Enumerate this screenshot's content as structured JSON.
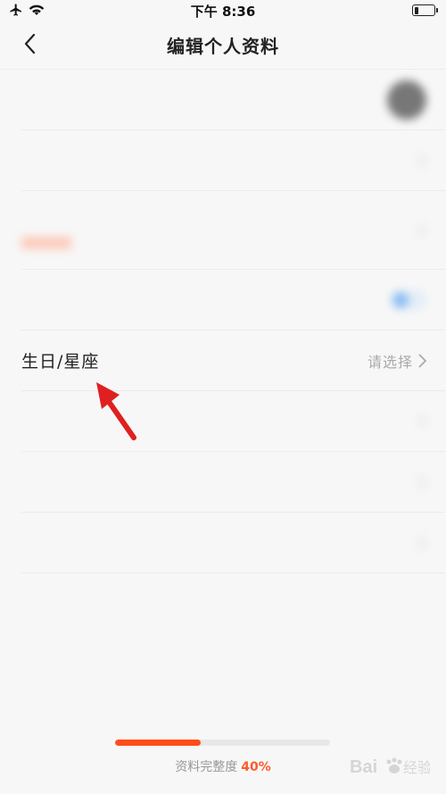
{
  "status_bar": {
    "time": "下午 8:36",
    "icons": [
      "airplane-icon",
      "wifi-icon",
      "battery-icon"
    ],
    "battery_level": 0.2
  },
  "nav": {
    "title": "编辑个人资料",
    "back_icon": "chevron-left-icon"
  },
  "rows": {
    "birthday": {
      "label": "生日/星座",
      "value": "请选择"
    }
  },
  "progress": {
    "caption": "资料完整度",
    "percent_text": "40%",
    "value": 0.4
  },
  "colors": {
    "accent": "#ff4e1a",
    "background": "#f7f7f7",
    "value_gray": "#aaaaaa"
  },
  "watermark": {
    "text": "Bai 经验"
  }
}
